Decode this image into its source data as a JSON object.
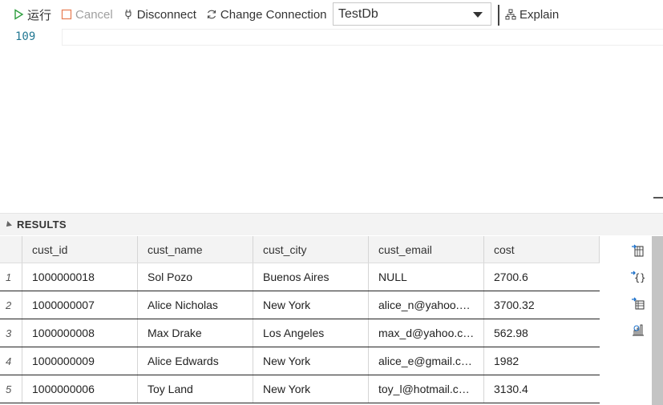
{
  "toolbar": {
    "run_label": "运行",
    "cancel_label": "Cancel",
    "disconnect_label": "Disconnect",
    "change_connection_label": "Change Connection",
    "database_selected": "TestDb",
    "explain_label": "Explain"
  },
  "editor": {
    "line_number": "109"
  },
  "results": {
    "title": "RESULTS",
    "columns": [
      "cust_id",
      "cust_name",
      "cust_city",
      "cust_email",
      "cost"
    ],
    "rows": [
      {
        "num": "1",
        "cells": [
          "1000000018",
          "Sol Pozo",
          "Buenos Aires",
          "NULL",
          "2700.6"
        ]
      },
      {
        "num": "2",
        "cells": [
          "1000000007",
          "Alice Nicholas",
          "New York",
          "alice_n@yahoo.…",
          "3700.32"
        ]
      },
      {
        "num": "3",
        "cells": [
          "1000000008",
          "Max Drake",
          "Los Angeles",
          "max_d@yahoo.c…",
          "562.98"
        ]
      },
      {
        "num": "4",
        "cells": [
          "1000000009",
          "Alice Edwards",
          "New York",
          "alice_e@gmail.c…",
          "1982"
        ]
      },
      {
        "num": "5",
        "cells": [
          "1000000006",
          "Toy Land",
          "New York",
          "toy_l@hotmail.c…",
          "3130.4"
        ]
      }
    ]
  },
  "icons": {
    "run": "play-icon",
    "cancel": "stop-icon",
    "disconnect": "plug-icon",
    "change_connection": "refresh-icon",
    "explain": "hierarchy-icon",
    "sidebar": [
      "save-csv-icon",
      "save-json-icon",
      "save-excel-icon",
      "chart-icon"
    ]
  },
  "colors": {
    "run_green": "#2e9e3e",
    "cancel_orange": "#e8825a",
    "line_number": "#237893",
    "accent_blue": "#1a6fc9"
  }
}
